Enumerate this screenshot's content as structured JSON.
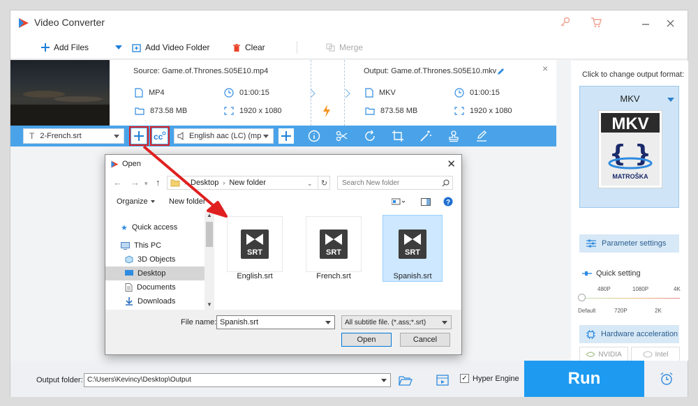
{
  "app": {
    "title": "Video Converter"
  },
  "toolbar": {
    "add_files": "Add Files",
    "add_video_folder": "Add Video Folder",
    "clear": "Clear",
    "merge": "Merge"
  },
  "file": {
    "source": "Source: Game.of.Thrones.S05E10.mp4",
    "output": "Output: Game.of.Thrones.S05E10.mkv",
    "src_format": "MP4",
    "src_duration": "01:00:15",
    "src_size": "873.58 MB",
    "src_resolution": "1920 x 1080",
    "out_format": "MKV",
    "out_duration": "01:00:15",
    "out_size": "873.58 MB",
    "out_resolution": "1920 x 1080"
  },
  "subtitle_bar": {
    "subtitle": "2-French.srt",
    "audio": "English aac (LC) (mp"
  },
  "right_panel": {
    "click_label": "Click to change output format:",
    "format_name": "MKV",
    "badge_text": "MKV",
    "badge_sub": "MATROŠKA",
    "parameter_settings": "Parameter settings",
    "quick_setting": "Quick setting",
    "ticks_top": [
      "480P",
      "1080P",
      "4K"
    ],
    "ticks_bottom": [
      "Default",
      "720P",
      "2K"
    ],
    "hardware_acceleration": "Hardware acceleration",
    "nvidia": "NVIDIA",
    "intel": "Intel"
  },
  "bottom": {
    "output_folder_label": "Output folder:",
    "output_folder_path": "C:\\Users\\Kevincy\\Desktop\\Output",
    "hyper_engine": "Hyper Engine",
    "run": "Run"
  },
  "dialog": {
    "title": "Open",
    "breadcrumb": [
      "Desktop",
      "New folder"
    ],
    "search_placeholder": "Search New folder",
    "organize": "Organize",
    "new_folder": "New folder",
    "nav": [
      "Quick access",
      "This PC",
      "3D Objects",
      "Desktop",
      "Documents",
      "Downloads"
    ],
    "files": [
      {
        "name": "English.srt",
        "badge": "SRT"
      },
      {
        "name": "French.srt",
        "badge": "SRT"
      },
      {
        "name": "Spanish.srt",
        "badge": "SRT"
      }
    ],
    "file_name_label": "File name:",
    "file_name_value": "Spanish.srt",
    "file_type": "All subtitle file. (*.ass;*.srt)",
    "open_button": "Open",
    "cancel_button": "Cancel"
  },
  "colors": {
    "accent": "#1e9bf0",
    "bar": "#4aa3e8",
    "highlight": "#e02020"
  }
}
